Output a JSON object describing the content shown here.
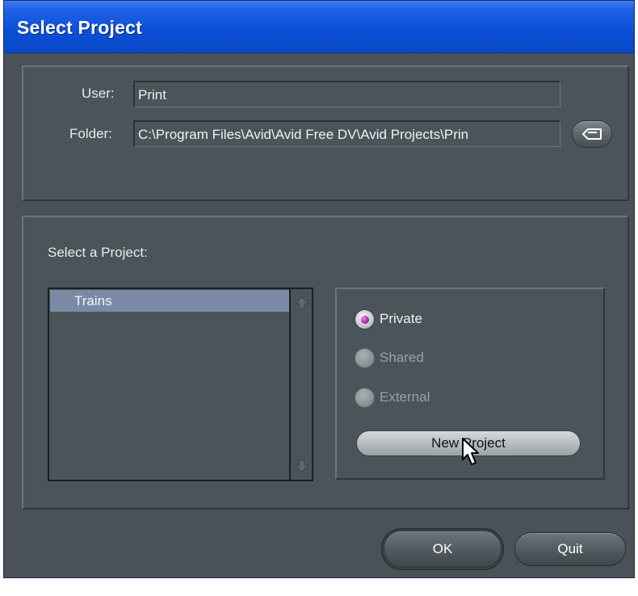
{
  "window": {
    "title": "Select Project"
  },
  "user_section": {
    "user_label": "User:",
    "user_value": "Print",
    "folder_label": "Folder:",
    "folder_value": "C:\\Program Files\\Avid\\Avid Free DV\\Avid Projects\\Prin",
    "browse_icon": "folder-browse-icon"
  },
  "project_section": {
    "heading": "Select a Project:",
    "projects": [
      "Trains"
    ],
    "selected_project": "Trains",
    "options": [
      {
        "label": "Private",
        "selected": true,
        "enabled": true
      },
      {
        "label": "Shared",
        "selected": false,
        "enabled": false
      },
      {
        "label": "External",
        "selected": false,
        "enabled": false
      }
    ],
    "new_project_label": "New Project"
  },
  "buttons": {
    "ok_label": "OK",
    "quit_label": "Quit"
  },
  "colors": {
    "titlebar": "#0b4fd8",
    "window_bg": "#4a5257",
    "selection": "#7a8aa4",
    "radio_accent": "#b41fb4",
    "disabled_text": "#9aa1a5"
  }
}
